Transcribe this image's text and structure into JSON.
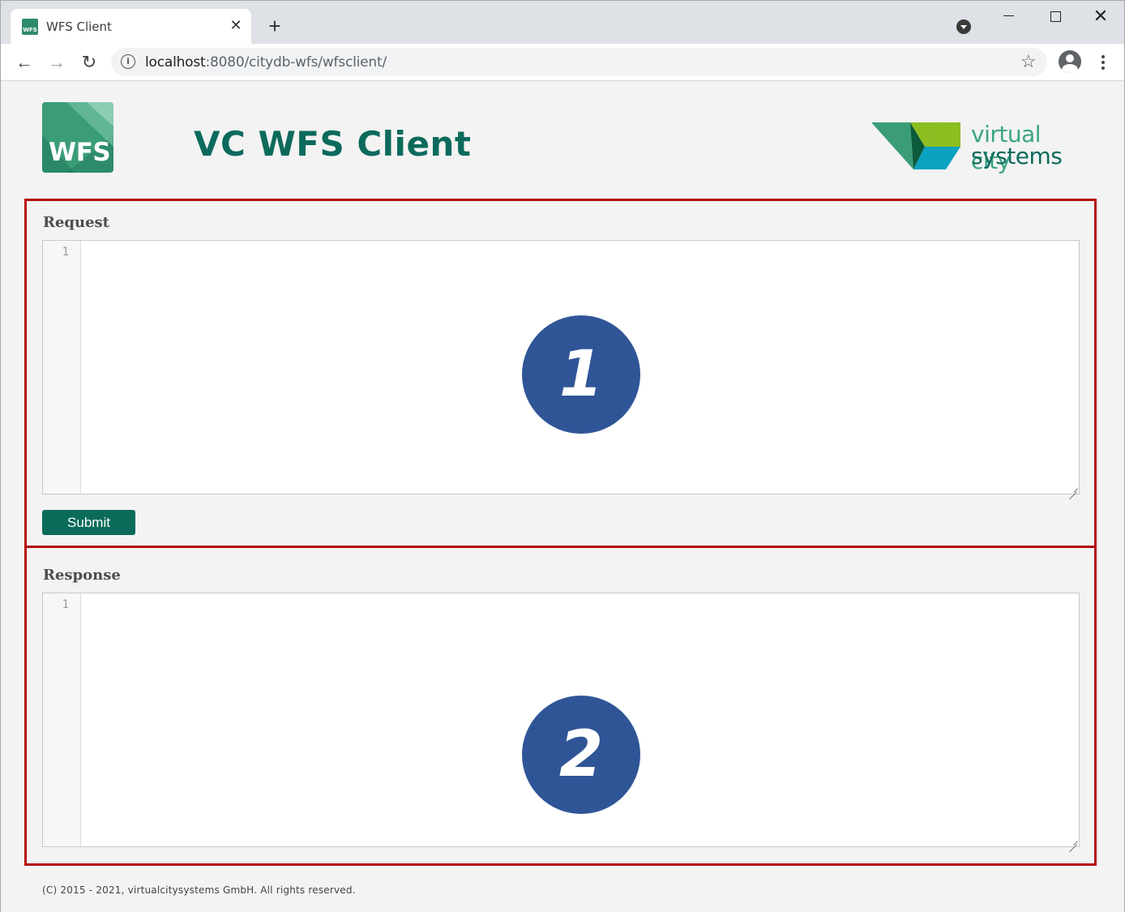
{
  "browser": {
    "tab_title": "WFS Client",
    "tab_favicon_text": "WFS",
    "url_host": "localhost",
    "url_path": ":8080/citydb-wfs/wfsclient/"
  },
  "header": {
    "logo_text": "WFS",
    "title": "VC WFS Client",
    "brand_line1": "virtual city",
    "brand_line2": "systems"
  },
  "request": {
    "label": "Request",
    "line_number": "1",
    "submit_label": "Submit",
    "marker": "1"
  },
  "response": {
    "label": "Response",
    "line_number": "1",
    "marker": "2"
  },
  "footer": {
    "text": "(C) 2015 - 2021, virtualcitysystems GmbH. All rights reserved."
  },
  "colors": {
    "brand_teal": "#0c6a5c",
    "brand_green": "#3ba583",
    "highlight_border": "#b50c0c",
    "marker_blue": "#2f5597",
    "submit_button": "#0a6b5a"
  }
}
